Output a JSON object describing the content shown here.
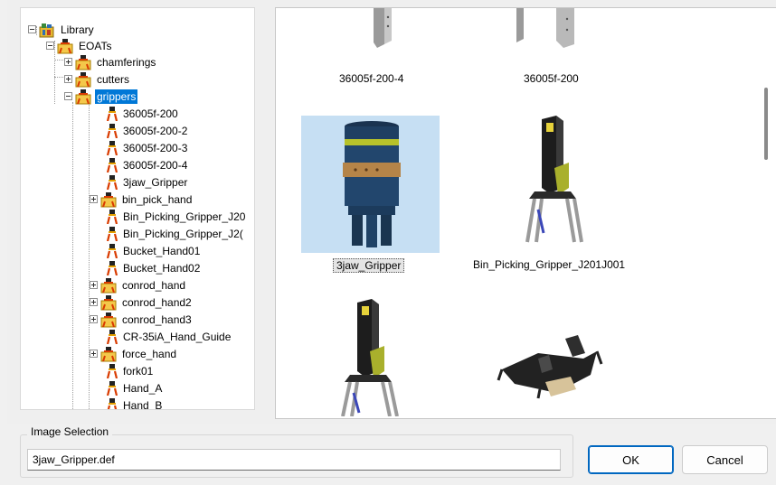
{
  "tree": {
    "nodes": [
      {
        "label": "Library",
        "icon": "library-icon"
      },
      {
        "label": "EOATs",
        "icon": "gripper-folder-icon"
      },
      {
        "label": "chamferings",
        "icon": "gripper-folder-icon"
      },
      {
        "label": "cutters",
        "icon": "gripper-folder-icon"
      },
      {
        "label": "grippers",
        "icon": "gripper-folder-icon",
        "selected": true
      },
      {
        "label": "36005f-200",
        "icon": "gripper-icon"
      },
      {
        "label": "36005f-200-2",
        "icon": "gripper-icon"
      },
      {
        "label": "36005f-200-3",
        "icon": "gripper-icon"
      },
      {
        "label": "36005f-200-4",
        "icon": "gripper-icon"
      },
      {
        "label": "3jaw_Gripper",
        "icon": "gripper-icon"
      },
      {
        "label": "bin_pick_hand",
        "icon": "gripper-folder-icon"
      },
      {
        "label": "Bin_Picking_Gripper_J20",
        "icon": "gripper-icon"
      },
      {
        "label": "Bin_Picking_Gripper_J2(",
        "icon": "gripper-icon"
      },
      {
        "label": "Bucket_Hand01",
        "icon": "gripper-icon"
      },
      {
        "label": "Bucket_Hand02",
        "icon": "gripper-icon"
      },
      {
        "label": "conrod_hand",
        "icon": "gripper-folder-icon"
      },
      {
        "label": "conrod_hand2",
        "icon": "gripper-folder-icon"
      },
      {
        "label": "conrod_hand3",
        "icon": "gripper-folder-icon"
      },
      {
        "label": "CR-35iA_Hand_Guide",
        "icon": "gripper-icon"
      },
      {
        "label": "force_hand",
        "icon": "gripper-folder-icon"
      },
      {
        "label": "fork01",
        "icon": "gripper-icon"
      },
      {
        "label": "Hand_A",
        "icon": "gripper-icon"
      },
      {
        "label": "Hand_B",
        "icon": "gripper-icon"
      }
    ]
  },
  "images": {
    "items": [
      {
        "caption": "36005f-200-4",
        "icon": "gripper-plate-icon"
      },
      {
        "caption": "36005f-200",
        "icon": "gripper-plate-icon"
      },
      {
        "caption": "3jaw_Gripper",
        "icon": "three-jaw-gripper-icon",
        "selected": true
      },
      {
        "caption": "Bin_Picking_Gripper_J201J001",
        "icon": "bin-picking-gripper-icon"
      },
      {
        "caption": "",
        "icon": "bin-picking-gripper-icon"
      },
      {
        "caption": "",
        "icon": "bucket-hand-icon"
      }
    ]
  },
  "selection": {
    "group_title": "Image Selection",
    "filename": "3jaw_Gripper.def"
  },
  "buttons": {
    "ok": "OK",
    "cancel": "Cancel"
  },
  "colors": {
    "selection": "#0078d7",
    "thumb_selected_bg": "#c6dff3",
    "yellow_accent": "#b8bf1c"
  }
}
